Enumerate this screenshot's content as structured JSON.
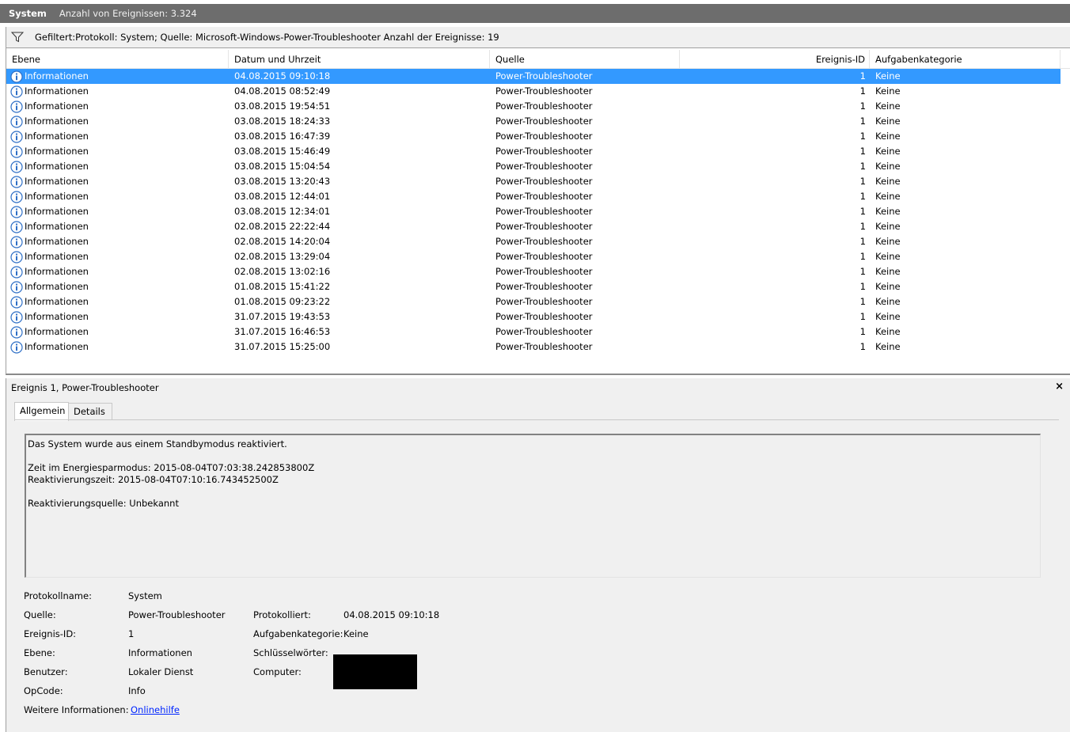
{
  "title": {
    "log": "System",
    "count": "Anzahl von Ereignissen: 3.324"
  },
  "filter": {
    "text": "Gefiltert:Protokoll: System; Quelle: Microsoft-Windows-Power-Troubleshooter Anzahl der Ereignisse: 19"
  },
  "columns": [
    "Ebene",
    "Datum und Uhrzeit",
    "Quelle",
    "Ereignis-ID",
    "Aufgabenkategorie"
  ],
  "rows": [
    {
      "level": "Informationen",
      "date": "04.08.2015 09:10:18",
      "source": "Power-Troubleshooter",
      "id": "1",
      "cat": "Keine"
    },
    {
      "level": "Informationen",
      "date": "04.08.2015 08:52:49",
      "source": "Power-Troubleshooter",
      "id": "1",
      "cat": "Keine"
    },
    {
      "level": "Informationen",
      "date": "03.08.2015 19:54:51",
      "source": "Power-Troubleshooter",
      "id": "1",
      "cat": "Keine"
    },
    {
      "level": "Informationen",
      "date": "03.08.2015 18:24:33",
      "source": "Power-Troubleshooter",
      "id": "1",
      "cat": "Keine"
    },
    {
      "level": "Informationen",
      "date": "03.08.2015 16:47:39",
      "source": "Power-Troubleshooter",
      "id": "1",
      "cat": "Keine"
    },
    {
      "level": "Informationen",
      "date": "03.08.2015 15:46:49",
      "source": "Power-Troubleshooter",
      "id": "1",
      "cat": "Keine"
    },
    {
      "level": "Informationen",
      "date": "03.08.2015 15:04:54",
      "source": "Power-Troubleshooter",
      "id": "1",
      "cat": "Keine"
    },
    {
      "level": "Informationen",
      "date": "03.08.2015 13:20:43",
      "source": "Power-Troubleshooter",
      "id": "1",
      "cat": "Keine"
    },
    {
      "level": "Informationen",
      "date": "03.08.2015 12:44:01",
      "source": "Power-Troubleshooter",
      "id": "1",
      "cat": "Keine"
    },
    {
      "level": "Informationen",
      "date": "03.08.2015 12:34:01",
      "source": "Power-Troubleshooter",
      "id": "1",
      "cat": "Keine"
    },
    {
      "level": "Informationen",
      "date": "02.08.2015 22:22:44",
      "source": "Power-Troubleshooter",
      "id": "1",
      "cat": "Keine"
    },
    {
      "level": "Informationen",
      "date": "02.08.2015 14:20:04",
      "source": "Power-Troubleshooter",
      "id": "1",
      "cat": "Keine"
    },
    {
      "level": "Informationen",
      "date": "02.08.2015 13:29:04",
      "source": "Power-Troubleshooter",
      "id": "1",
      "cat": "Keine"
    },
    {
      "level": "Informationen",
      "date": "02.08.2015 13:02:16",
      "source": "Power-Troubleshooter",
      "id": "1",
      "cat": "Keine"
    },
    {
      "level": "Informationen",
      "date": "01.08.2015 15:41:22",
      "source": "Power-Troubleshooter",
      "id": "1",
      "cat": "Keine"
    },
    {
      "level": "Informationen",
      "date": "01.08.2015 09:23:22",
      "source": "Power-Troubleshooter",
      "id": "1",
      "cat": "Keine"
    },
    {
      "level": "Informationen",
      "date": "31.07.2015 19:43:53",
      "source": "Power-Troubleshooter",
      "id": "1",
      "cat": "Keine"
    },
    {
      "level": "Informationen",
      "date": "31.07.2015 16:46:53",
      "source": "Power-Troubleshooter",
      "id": "1",
      "cat": "Keine"
    },
    {
      "level": "Informationen",
      "date": "31.07.2015 15:25:00",
      "source": "Power-Troubleshooter",
      "id": "1",
      "cat": "Keine"
    }
  ],
  "detail": {
    "title": "Ereignis 1, Power-Troubleshooter",
    "close": "×",
    "tabs": [
      "Allgemein",
      "Details"
    ],
    "message": [
      "Das System wurde aus einem Standbymodus reaktiviert.",
      "",
      "Zeit im Energiesparmodus: 2015-08-04T07:03:38.242853800Z",
      "Reaktivierungszeit: 2015-08-04T07:10:16.743452500Z",
      "",
      "Reaktivierungsquelle: Unbekannt"
    ],
    "labels": {
      "logname": "Protokollname:",
      "source": "Quelle:",
      "eventid": "Ereignis-ID:",
      "level": "Ebene:",
      "user": "Benutzer:",
      "opcode": "OpCode:",
      "moreinfo": "Weitere Informationen:",
      "logged": "Protokolliert:",
      "taskcat": "Aufgabenkategorie:",
      "keywords": "Schlüsselwörter:",
      "computer": "Computer:"
    },
    "values": {
      "logname": "System",
      "source": "Power-Troubleshooter",
      "eventid": "1",
      "level": "Informationen",
      "user": "Lokaler Dienst",
      "opcode": "Info",
      "moreinfo": "Onlinehilfe",
      "logged": "04.08.2015 09:10:18",
      "taskcat": "Keine"
    }
  },
  "colors": {
    "selection": "#3399ff",
    "titlebar": "#6d6d6d",
    "link": "#0026ff",
    "info_icon": "#2e6fc6"
  },
  "icons": {
    "filter": "filter-icon",
    "info": "info-icon",
    "close": "close-icon"
  }
}
